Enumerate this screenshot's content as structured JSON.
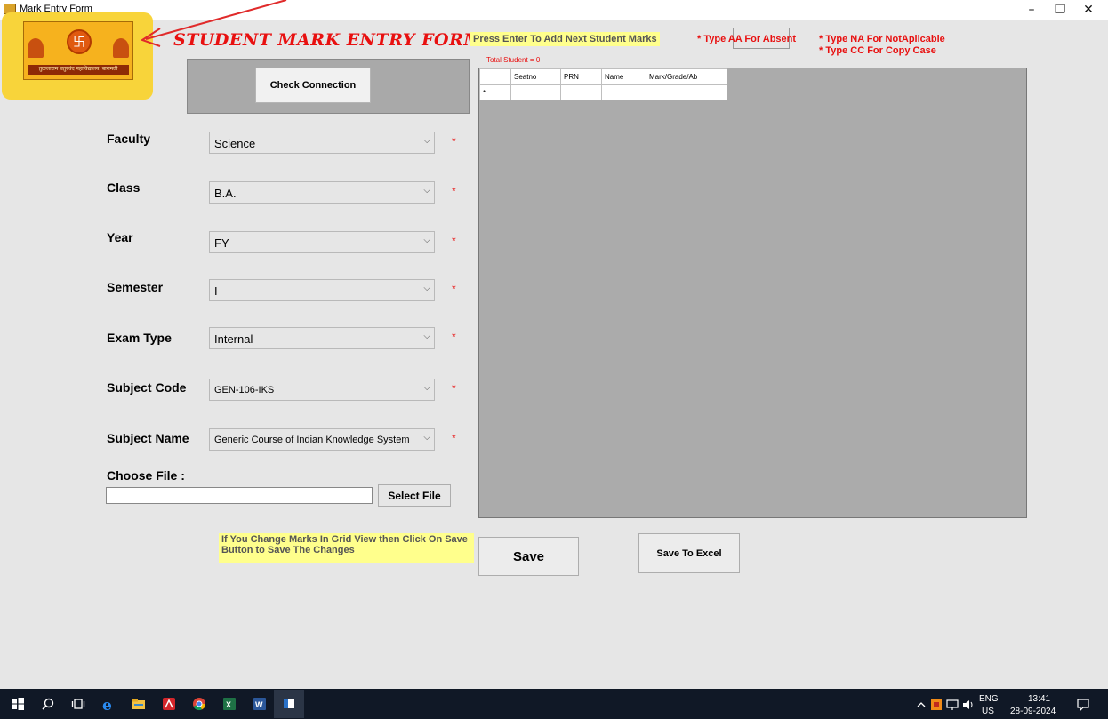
{
  "window": {
    "title": "Mark Entry Form",
    "minimize_glyph": "–",
    "maximize_glyph": "❐",
    "close_glyph": "✕"
  },
  "logo": {
    "symbol": "卐",
    "band_text": "तुळजाराम चतुरचंद महाविद्यालय, बारामती"
  },
  "header": {
    "title": "STUDENT MARK ENTRY FORM",
    "enter_hint": "Press Enter To Add Next Student Marks",
    "hint_aa": "* Type AA For Absent",
    "hint_na": "* Type NA For NotAplicable",
    "hint_cc": "* Type CC For Copy Case"
  },
  "connection": {
    "check_label": "Check Connection"
  },
  "form": {
    "faculty": {
      "label": "Faculty",
      "value": "Science"
    },
    "class": {
      "label": "Class",
      "value": "B.A."
    },
    "year": {
      "label": "Year",
      "value": "FY"
    },
    "semester": {
      "label": "Semester",
      "value": "I"
    },
    "exam_type": {
      "label": "Exam Type",
      "value": "Internal"
    },
    "subject_code": {
      "label": "Subject Code",
      "value": "GEN-106-IKS"
    },
    "subject_name": {
      "label": "Subject Name",
      "value": "Generic Course of Indian Knowledge System"
    },
    "required_mark": "*",
    "dropdown_glyph": "⌵",
    "choose_file_label": "Choose File :",
    "file_value": "",
    "select_file_label": "Select File"
  },
  "grid": {
    "total_label": "Total Student = 0",
    "columns": [
      "Seatno",
      "PRN",
      "Name",
      "Mark/Grade/Ab"
    ],
    "new_row_marker": "*"
  },
  "footer": {
    "note": "If You Change Marks In Grid View then Click On Save Button to Save The Changes",
    "save_label": "Save",
    "excel_label": "Save To Excel"
  },
  "taskbar": {
    "language": "ENG",
    "region": "US",
    "time": "13:41",
    "date": "28-09-2024"
  },
  "colors": {
    "accent_red": "#e81010",
    "hint_yellow": "#ffff8c",
    "grid_gray": "#ababab",
    "taskbar": "#101826"
  }
}
